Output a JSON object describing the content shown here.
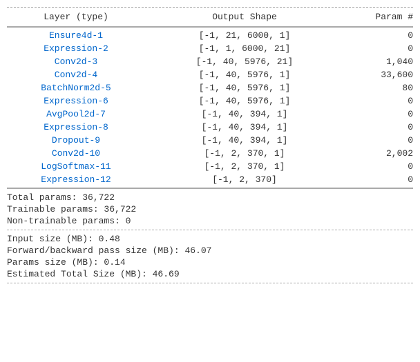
{
  "header": {
    "col_layer": "Layer (type)",
    "col_shape": "Output Shape",
    "col_param": "Param #"
  },
  "rows": [
    {
      "layer": "Ensure4d-1",
      "shape": "[-1, 21, 6000, 1]",
      "param": "0"
    },
    {
      "layer": "Expression-2",
      "shape": "[-1, 1, 6000, 21]",
      "param": "0"
    },
    {
      "layer": "Conv2d-3",
      "shape": "[-1, 40, 5976, 21]",
      "param": "1,040"
    },
    {
      "layer": "Conv2d-4",
      "shape": "[-1, 40, 5976, 1]",
      "param": "33,600"
    },
    {
      "layer": "BatchNorm2d-5",
      "shape": "[-1, 40, 5976, 1]",
      "param": "80"
    },
    {
      "layer": "Expression-6",
      "shape": "[-1, 40, 5976, 1]",
      "param": "0"
    },
    {
      "layer": "AvgPool2d-7",
      "shape": "[-1, 40, 394, 1]",
      "param": "0"
    },
    {
      "layer": "Expression-8",
      "shape": "[-1, 40, 394, 1]",
      "param": "0"
    },
    {
      "layer": "Dropout-9",
      "shape": "[-1, 40, 394, 1]",
      "param": "0"
    },
    {
      "layer": "Conv2d-10",
      "shape": "[-1, 2, 370, 1]",
      "param": "2,002"
    },
    {
      "layer": "LogSoftmax-11",
      "shape": "[-1, 2, 370, 1]",
      "param": "0"
    },
    {
      "layer": "Expression-12",
      "shape": "[-1, 2, 370]",
      "param": "0"
    }
  ],
  "summary": {
    "total": "Total params: 36,722",
    "trainable": "Trainable params: 36,722",
    "non_train": "Non-trainable params: 0"
  },
  "info": {
    "input_size": "Input size (MB): 0.48",
    "fwd_bwd": "Forward/backward pass size (MB): 46.07",
    "params_size": "Params size (MB): 0.14",
    "total_size": "Estimated Total Size (MB): 46.69"
  }
}
